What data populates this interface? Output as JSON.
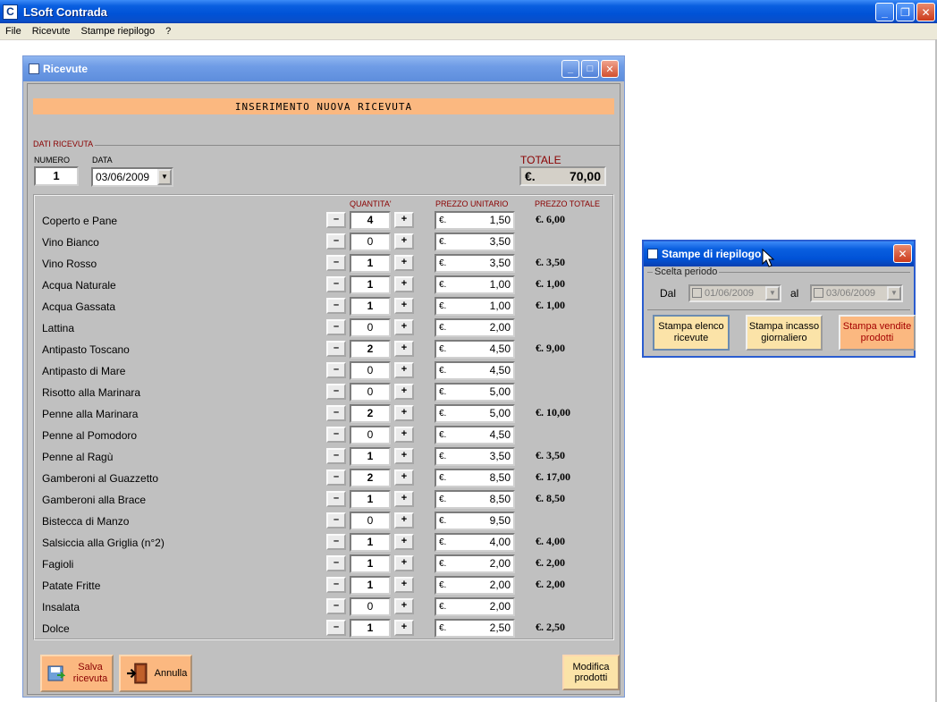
{
  "app": {
    "title": "LSoft Contrada"
  },
  "menu": [
    "File",
    "Ricevute",
    "Stampe riepilogo",
    "?"
  ],
  "ricevute": {
    "window_title": "Ricevute",
    "banner": "INSERIMENTO NUOVA RICEVUTA",
    "section_label": "DATI RICEVUTA",
    "numero_label": "NUMERO",
    "numero_value": "1",
    "data_label": "DATA",
    "data_value": "03/06/2009",
    "totale_label": "TOTALE",
    "totale_currency": "€.",
    "totale_value": "70,00",
    "col_quantita": "QUANTITA'",
    "col_prezzo_unitario": "PREZZO UNITARIO",
    "col_prezzo_totale": "PREZZO TOTALE",
    "currency": "€.",
    "minus": "–",
    "plus": "+",
    "items": [
      {
        "name": "Coperto e Pane",
        "qty": "4",
        "price": "1,50",
        "total": "€. 6,00"
      },
      {
        "name": "Vino Bianco",
        "qty": "0",
        "price": "3,50",
        "total": ""
      },
      {
        "name": "Vino Rosso",
        "qty": "1",
        "price": "3,50",
        "total": "€. 3,50"
      },
      {
        "name": "Acqua Naturale",
        "qty": "1",
        "price": "1,00",
        "total": "€. 1,00"
      },
      {
        "name": "Acqua Gassata",
        "qty": "1",
        "price": "1,00",
        "total": "€. 1,00"
      },
      {
        "name": "Lattina",
        "qty": "0",
        "price": "2,00",
        "total": ""
      },
      {
        "name": "Antipasto Toscano",
        "qty": "2",
        "price": "4,50",
        "total": "€. 9,00"
      },
      {
        "name": "Antipasto di Mare",
        "qty": "0",
        "price": "4,50",
        "total": ""
      },
      {
        "name": "Risotto alla Marinara",
        "qty": "0",
        "price": "5,00",
        "total": ""
      },
      {
        "name": "Penne alla Marinara",
        "qty": "2",
        "price": "5,00",
        "total": "€. 10,00"
      },
      {
        "name": "Penne al Pomodoro",
        "qty": "0",
        "price": "4,50",
        "total": ""
      },
      {
        "name": "Penne al Ragù",
        "qty": "1",
        "price": "3,50",
        "total": "€. 3,50"
      },
      {
        "name": "Gamberoni al Guazzetto",
        "qty": "2",
        "price": "8,50",
        "total": "€. 17,00"
      },
      {
        "name": "Gamberoni alla Brace",
        "qty": "1",
        "price": "8,50",
        "total": "€. 8,50"
      },
      {
        "name": "Bistecca di Manzo",
        "qty": "0",
        "price": "9,50",
        "total": ""
      },
      {
        "name": "Salsiccia alla Griglia (n°2)",
        "qty": "1",
        "price": "4,00",
        "total": "€. 4,00"
      },
      {
        "name": "Fagioli",
        "qty": "1",
        "price": "2,00",
        "total": "€. 2,00"
      },
      {
        "name": "Patate Fritte",
        "qty": "1",
        "price": "2,00",
        "total": "€. 2,00"
      },
      {
        "name": "Insalata",
        "qty": "0",
        "price": "2,00",
        "total": ""
      },
      {
        "name": "Dolce",
        "qty": "1",
        "price": "2,50",
        "total": "€. 2,50"
      }
    ],
    "save_label_1": "Salva",
    "save_label_2": "ricevuta",
    "cancel_label": "Annulla",
    "modifica_label_1": "Modifica",
    "modifica_label_2": "prodotti"
  },
  "stampe": {
    "window_title": "Stampe di riepilogo",
    "period_label": "Scelta periodo",
    "dal_label": "Dal",
    "al_label": "al",
    "date_from": "01/06/2009",
    "date_to": "03/06/2009",
    "btn_elenco_1": "Stampa elenco",
    "btn_elenco_2": "ricevute",
    "btn_incasso_1": "Stampa incasso",
    "btn_incasso_2": "giornaliero",
    "btn_vendite_1": "Stampa vendite",
    "btn_vendite_2": "prodotti"
  },
  "colors": {
    "banner": "#fbb880",
    "label_red": "#8a0000",
    "xp_blue": "#0052d6"
  }
}
